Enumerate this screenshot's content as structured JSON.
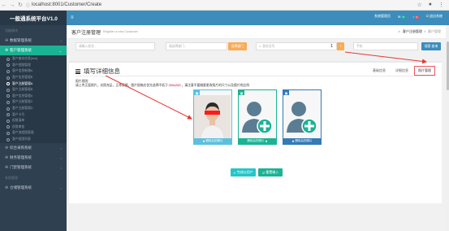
{
  "browser": {
    "url": "localhost:8001/Customer/Create"
  },
  "sidebar": {
    "brand": "一般通系统平台V1.0",
    "section_main": "功能模块",
    "section_sys": "系统管理",
    "items": [
      {
        "label": "数据管理系统",
        "active": false
      },
      {
        "label": "客户管理系统",
        "active": true
      },
      {
        "label": "综合采购系统",
        "active": false
      },
      {
        "label": "财务管理系统",
        "active": false
      },
      {
        "label": "门禁管理系统",
        "active": false
      },
      {
        "label": "仓储管理系统",
        "active": false
      }
    ],
    "subitems": [
      "客户基本信息(test)",
      "客户视频管理",
      "客户信息新增A",
      "客户信息管理B",
      "客户注册管理A",
      "客户注册管理B",
      "客户信息管理A",
      "客户注册管理C",
      "客户注册管理D",
      "客户卡号",
      "权限清单",
      "权限审批",
      "客户流程图管理",
      "客户权限列表"
    ],
    "current_subitem_index": 4
  },
  "topbar": {
    "items": [
      "系统管理员",
      "消息",
      "设置",
      "退出系统"
    ],
    "badge_msg": "8",
    "badge_set": "2"
  },
  "content_header": {
    "title": "客户注册管理",
    "subtitle": "Register a new Customer",
    "breadcrumb": [
      "客户注册管理",
      "/",
      "客户管理"
    ]
  },
  "filters": {
    "name_placeholder": "请输入姓名...",
    "dept_placeholder": "请选择部门...",
    "dept_btn": "选择部门",
    "id_placeholder": "身份证号",
    "count": "1",
    "phone_placeholder": "手机",
    "search_btn": "搜索 查询"
  },
  "panel": {
    "title": "填写详细信息",
    "tabs": [
      "基础信息",
      "详细信息",
      "照片管理"
    ],
    "active_tab": 2,
    "hint1": "照片规则：",
    "hint2_a": "请上传正面照片，光照充足，正常表情，图片规格应优先选择不低于",
    "hint2_code": "200x200",
    "hint2_b": "，请注意不要随意更改照片的尺寸以及图片的比例",
    "cards": [
      {
        "footer": "删除后的照片",
        "kind": "photo"
      },
      {
        "footer": "删除后的照片",
        "kind": "add"
      },
      {
        "footer": "删除后的照片",
        "kind": "add"
      }
    ],
    "btn_save": "完成以用户",
    "btn_reset": "重置输入"
  },
  "colors": {
    "sidebar_bg": "#2f4050",
    "accent": "#1ab394",
    "topbar": "#3c8dbc",
    "arrow": "#e53935"
  }
}
